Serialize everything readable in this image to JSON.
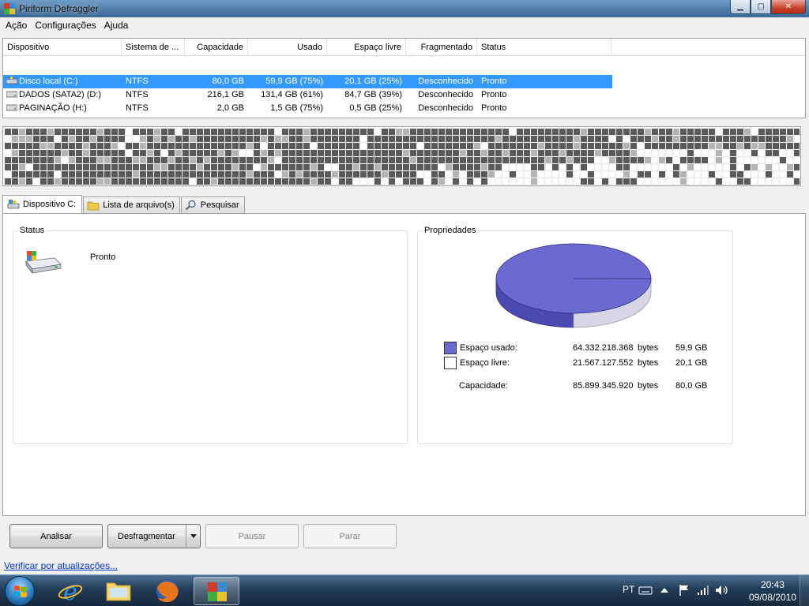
{
  "window": {
    "title": "Piriform Defraggler",
    "minimize": "▁",
    "maximize": "▢",
    "close": "✕"
  },
  "menu": [
    "Ação",
    "Configurações",
    "Ajuda"
  ],
  "drive_list": {
    "columns": [
      "Dispositivo",
      "Sistema de ...",
      "Capacidade",
      "Usado",
      "Espaço livre",
      "Fragmentado",
      "Status"
    ],
    "rows": [
      {
        "name": "Disco local (C:)",
        "fs": "NTFS",
        "capacity": "80,0 GB",
        "used": "59,9 GB (75%)",
        "free": "20,1 GB (25%)",
        "fragmented": "Desconhecido",
        "status": "Pronto",
        "selected": true
      },
      {
        "name": "DADOS (SATA2) (D:)",
        "fs": "NTFS",
        "capacity": "216,1 GB",
        "used": "131,4 GB (61%)",
        "free": "84,7 GB (39%)",
        "fragmented": "Desconhecido",
        "status": "Pronto",
        "selected": false
      },
      {
        "name": "PAGINAÇÃO (H:)",
        "fs": "NTFS",
        "capacity": "2,0 GB",
        "used": "1,5 GB (75%)",
        "free": "0,5 GB (25%)",
        "fragmented": "Desconhecido",
        "status": "Pronto",
        "selected": false
      }
    ]
  },
  "cluster_map": {
    "used_color": "#5a5a5a",
    "light_color": "#b4b4b4",
    "free_color": "#ffffff"
  },
  "tabs": [
    {
      "label": "Dispositivo C:",
      "icon": "drive-icon",
      "active": true
    },
    {
      "label": "Lista de arquivo(s)",
      "icon": "folder-icon",
      "active": false
    },
    {
      "label": "Pesquisar",
      "icon": "magnifier-icon",
      "active": false
    }
  ],
  "status_panel": {
    "title": "Status",
    "value": "Pronto"
  },
  "properties_panel": {
    "title": "Propriedades",
    "rows": [
      {
        "label": "Espaço usado:",
        "bytes": "64.332.218.368",
        "unit": "bytes",
        "size": "59,9 GB"
      },
      {
        "label": "Espaço livre:",
        "bytes": "21.567.127.552",
        "unit": "bytes",
        "size": "20,1 GB"
      },
      {
        "label": "Capacidade:",
        "bytes": "85.899.345.920",
        "unit": "bytes",
        "size": "80,0 GB"
      }
    ],
    "used_fraction": 0.749,
    "used_color": "#6a6ad0",
    "free_color": "#ffffff"
  },
  "buttons": {
    "analyze": "Analisar",
    "defrag": "Desfragmentar",
    "pause": "Pausar",
    "stop": "Parar"
  },
  "update_link": "Verificar por atualizações...",
  "taskbar": {
    "language": "PT",
    "time": "20:43",
    "date": "09/08/2010"
  }
}
